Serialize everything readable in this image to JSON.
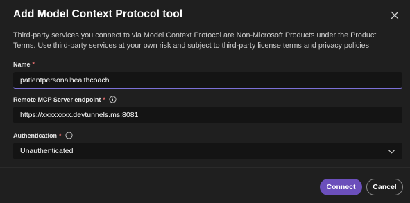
{
  "dialog": {
    "title": "Add Model Context Protocol tool",
    "close_icon": "close-icon",
    "disclaimer": "Third-party services you connect to via Model Context Protocol are Non-Microsoft Products under the Product Terms. Use third-party services at your own risk and subject to third-party license terms and privacy policies."
  },
  "fields": {
    "name": {
      "label": "Name",
      "required_mark": "*",
      "value": "patientpersonalhealthcoach"
    },
    "endpoint": {
      "label": "Remote MCP Server endpoint",
      "required_mark": "*",
      "info_icon": "info-icon",
      "value": "https://xxxxxxxx.devtunnels.ms:8081"
    },
    "authentication": {
      "label": "Authentication",
      "required_mark": "*",
      "info_icon": "info-icon",
      "selected": "Unauthenticated",
      "chevron_icon": "chevron-down-icon"
    }
  },
  "actions": {
    "connect_label": "Connect",
    "cancel_label": "Cancel"
  },
  "colors": {
    "accent": "#6b4fbb",
    "focus_underline": "#7b70d6",
    "required": "#e06c6c",
    "background": "#1f1f1f",
    "input_background": "#141414"
  }
}
